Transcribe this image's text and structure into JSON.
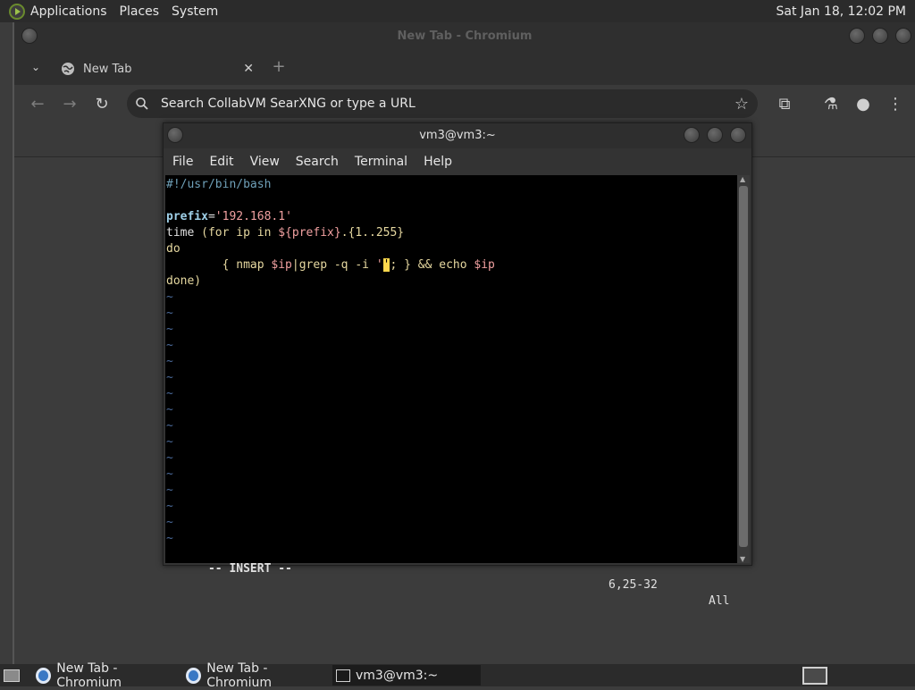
{
  "top_panel": {
    "menu": [
      "Applications",
      "Places",
      "System"
    ],
    "clock": "Sat Jan 18, 12:02 PM"
  },
  "browser": {
    "window_title": "New Tab - Chromium",
    "tab_label": "New Tab",
    "omnibox_placeholder": "Search CollabVM SearXNG or type a URL"
  },
  "terminal": {
    "window_title": "vm3@vm3:~",
    "menu": [
      "File",
      "Edit",
      "View",
      "Search",
      "Terminal",
      "Help"
    ],
    "lines": {
      "shebang": "#!/usr/bin/bash",
      "prefix_var": "prefix",
      "prefix_eq": "=",
      "prefix_val": "'192.168.1'",
      "time_a": "time ",
      "time_b": "(for ip in ",
      "time_c": "${prefix}",
      "time_d": ".{1..255}",
      "do": "do",
      "cmd_a": "        { nmap ",
      "cmd_b": "$ip",
      "cmd_c": "|grep -q -i ",
      "cmd_d": "'",
      "cmd_cursor": "'",
      "cmd_e": "; } && echo ",
      "cmd_f": "$ip",
      "done": "done)",
      "tilde": "~"
    },
    "status_mode": "-- INSERT --",
    "status_pos": "6,25-32",
    "status_all": "All"
  },
  "taskbar": {
    "items": [
      "New Tab - Chromium",
      "New Tab - Chromium",
      "vm3@vm3:~"
    ]
  }
}
